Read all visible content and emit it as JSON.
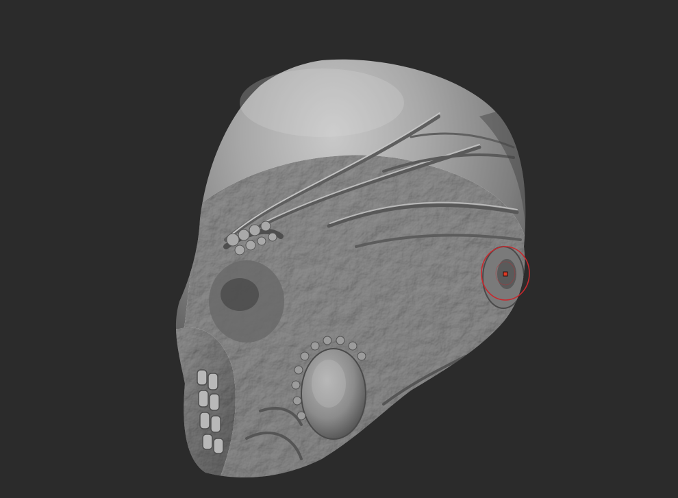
{
  "viewport": {
    "background_color": "#2b2b2b",
    "model": {
      "subject": "sculpted-alien-head",
      "base_color": "#8a8a8a",
      "highlight_color": "#cfcfcf",
      "shadow_color": "#3a3a3a"
    },
    "brush": {
      "icon": "brush-cursor-icon",
      "ring_color": "#c8282d",
      "center_color": "#e03a22"
    }
  }
}
